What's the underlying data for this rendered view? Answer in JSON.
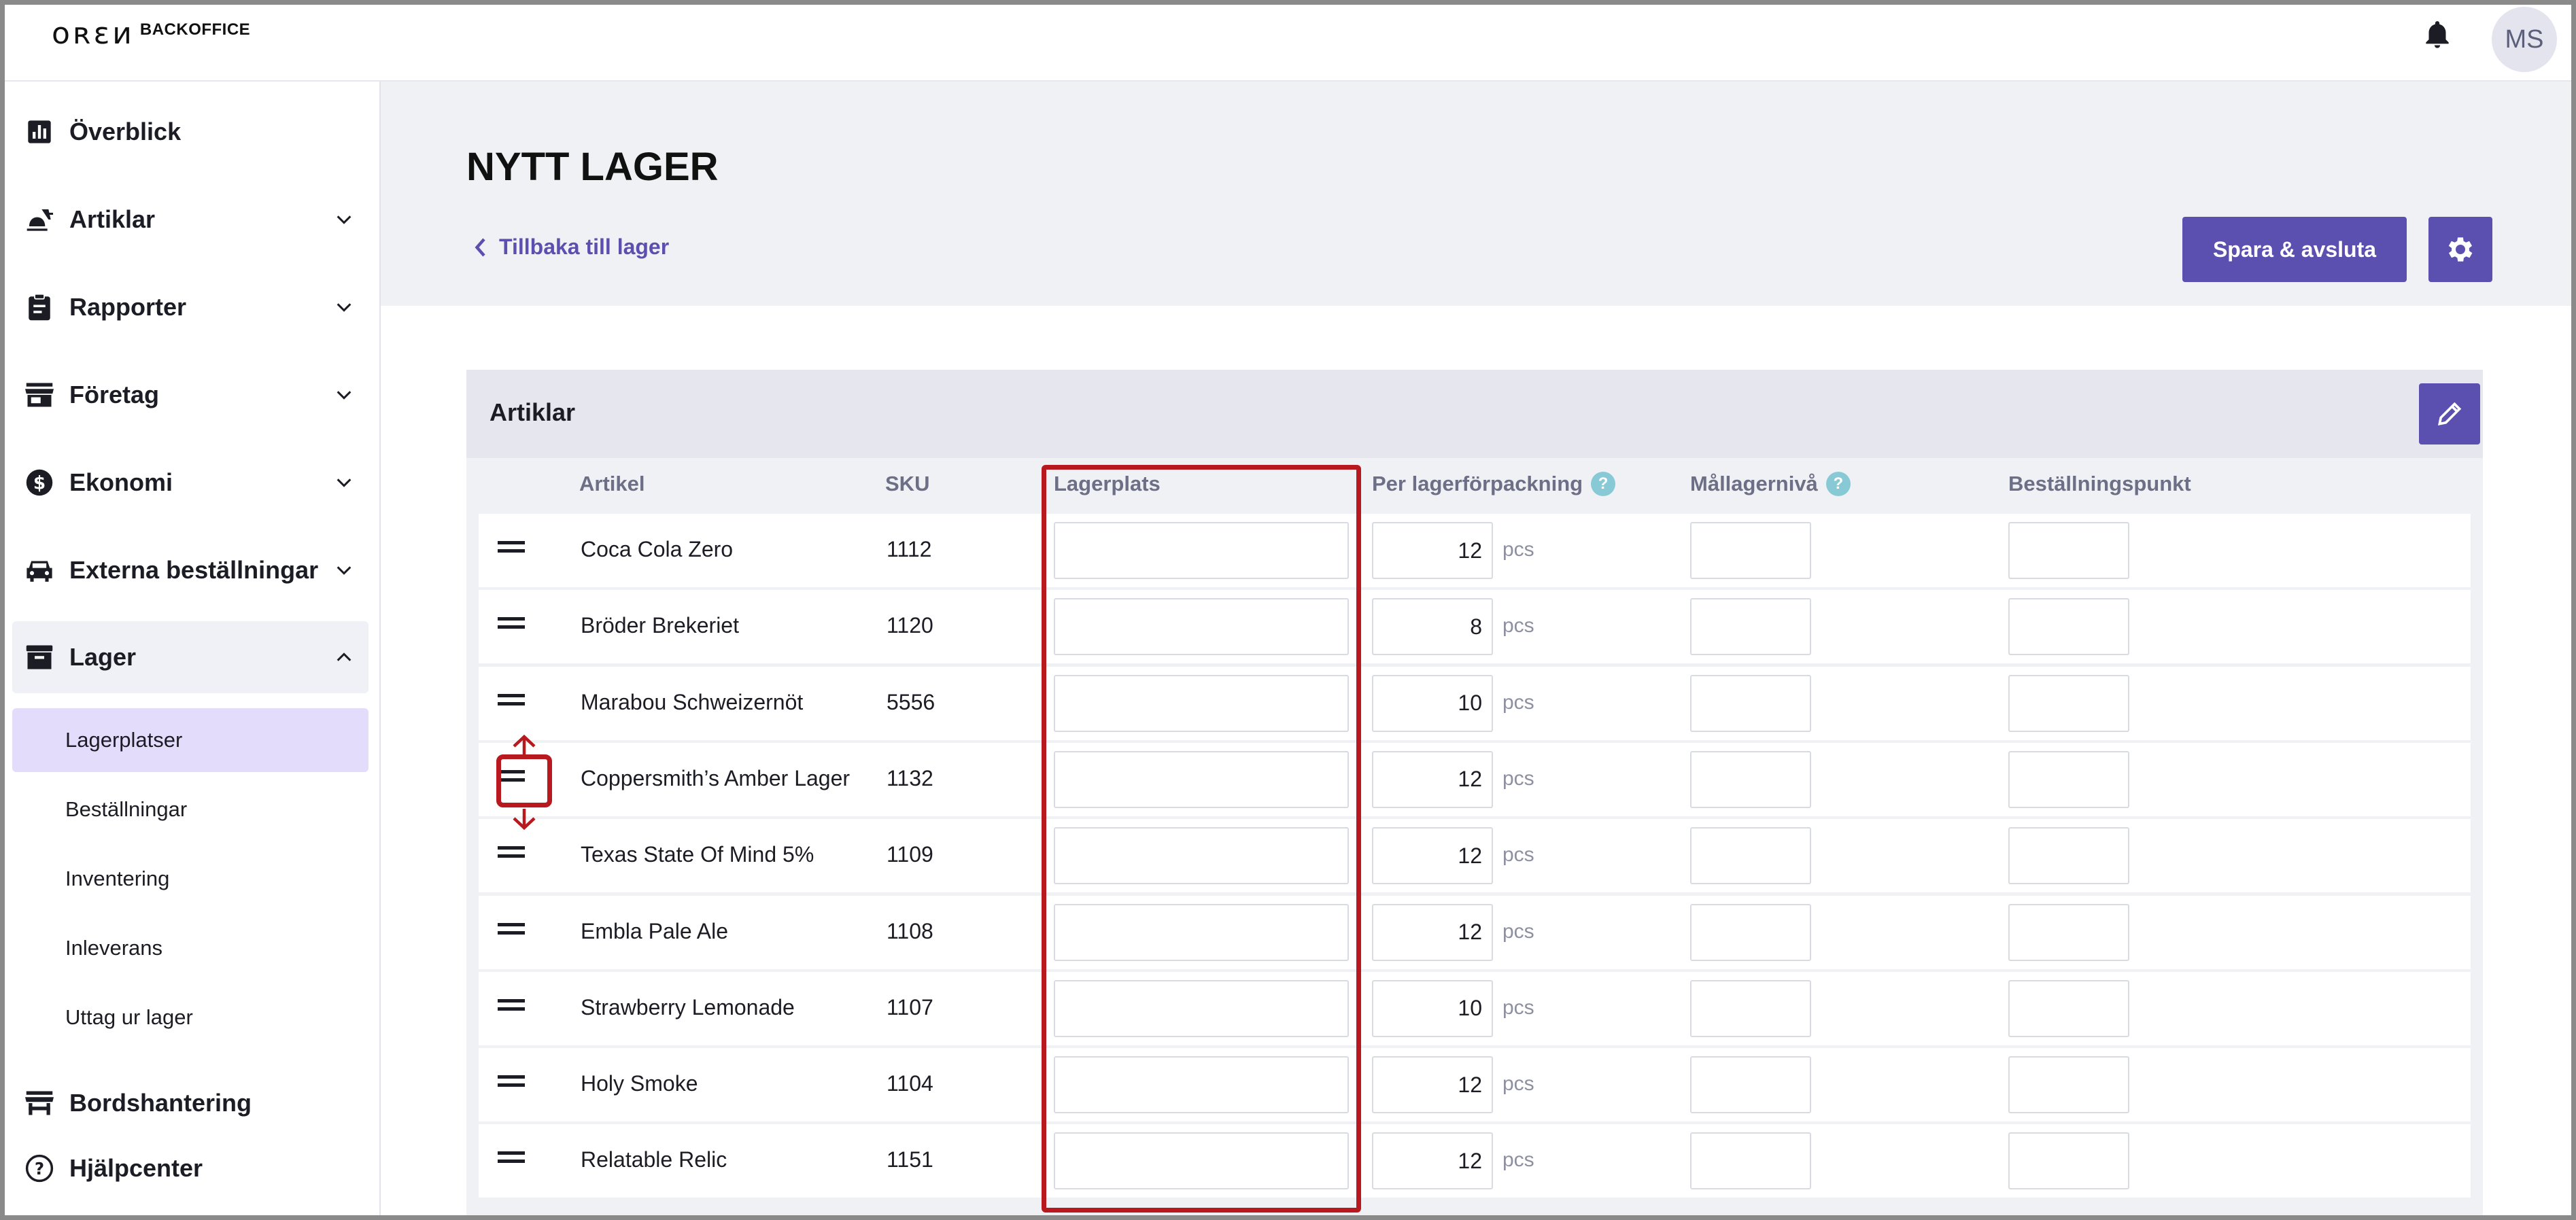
{
  "header": {
    "logo_text": "BACKOFFICE",
    "avatar_initials": "MS"
  },
  "sidebar": {
    "items": [
      {
        "label": "Överblick",
        "icon": "bar-chart-icon"
      },
      {
        "label": "Artiklar",
        "icon": "food-icon"
      },
      {
        "label": "Rapporter",
        "icon": "clipboard-icon"
      },
      {
        "label": "Företag",
        "icon": "store-icon"
      },
      {
        "label": "Ekonomi",
        "icon": "dollar-icon"
      },
      {
        "label": "Externa beställningar",
        "icon": "car-icon"
      },
      {
        "label": "Lager",
        "icon": "archive-icon"
      }
    ],
    "lager_sub": [
      "Lagerplatser",
      "Beställningar",
      "Inventering",
      "Inleverans",
      "Uttag ur lager"
    ],
    "bottom": [
      {
        "label": "Bordshantering",
        "icon": "table-store-icon"
      },
      {
        "label": "Hjälpcenter",
        "icon": "help-circle-icon"
      }
    ]
  },
  "page": {
    "title": "NYTT LAGER",
    "back_label": "Tillbaka till lager",
    "save_label": "Spara & avsluta"
  },
  "table": {
    "title": "Artiklar",
    "columns": {
      "artikel": "Artikel",
      "sku": "SKU",
      "lagerplats": "Lagerplats",
      "per_pack": "Per lagerförpackning",
      "target": "Mållagernivå",
      "order_point": "Beställningspunkt"
    },
    "unit": "pcs",
    "rows": [
      {
        "name": "Coca Cola Zero",
        "sku": "1112",
        "per_pack": "12"
      },
      {
        "name": "Bröder Brekeriet",
        "sku": "1120",
        "per_pack": "8"
      },
      {
        "name": "Marabou Schweizernöt",
        "sku": "5556",
        "per_pack": "10"
      },
      {
        "name": "Coppersmith’s Amber Lager",
        "sku": "1132",
        "per_pack": "12"
      },
      {
        "name": "Texas State Of Mind 5%",
        "sku": "1109",
        "per_pack": "12"
      },
      {
        "name": "Embla Pale Ale",
        "sku": "1108",
        "per_pack": "12"
      },
      {
        "name": "Strawberry Lemonade",
        "sku": "1107",
        "per_pack": "10"
      },
      {
        "name": "Holy Smoke",
        "sku": "1104",
        "per_pack": "12"
      },
      {
        "name": "Relatable Relic",
        "sku": "1151",
        "per_pack": "12"
      }
    ]
  },
  "colors": {
    "accent": "#5b4fb0",
    "highlight": "#b8191f",
    "active_sub": "#e3dcfb"
  }
}
